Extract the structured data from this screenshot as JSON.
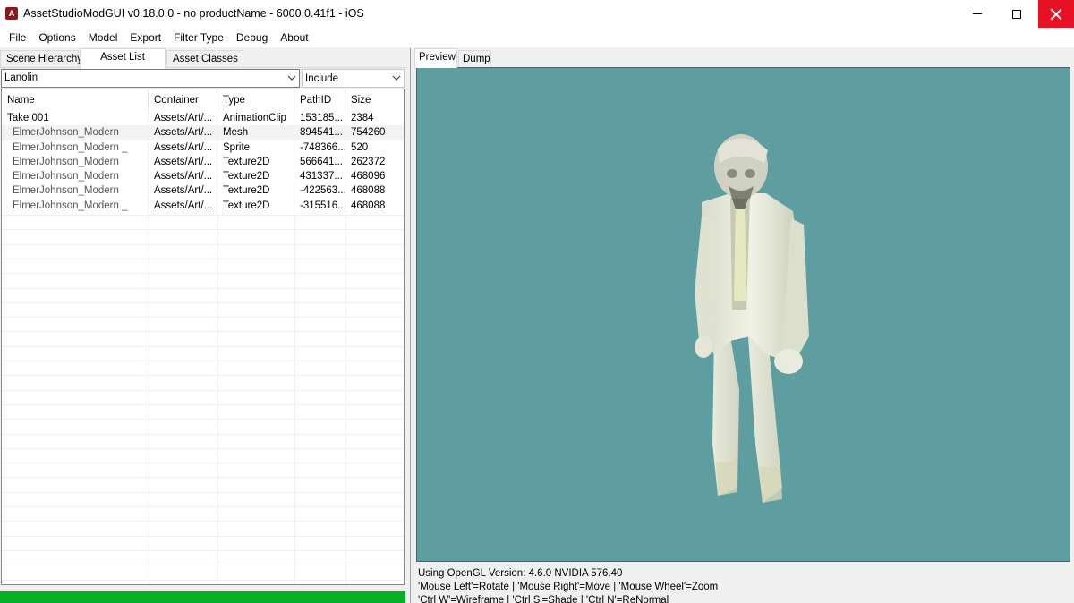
{
  "window": {
    "title": "AssetStudioModGUI v0.18.0.0 - no productName - 6000.0.41f1 - iOS",
    "icon_text": "A"
  },
  "menu": [
    "File",
    "Options",
    "Model",
    "Export",
    "Filter Type",
    "Debug",
    "About"
  ],
  "left_tabs": [
    "Scene Hierarchy",
    "Asset List",
    "Asset Classes"
  ],
  "active_left_tab": "Asset List",
  "filter": {
    "value": "Lanolin",
    "mode": "Include"
  },
  "columns": [
    "Name",
    "Container",
    "Type",
    "PathID",
    "Size"
  ],
  "rows": [
    {
      "name": "Take 001",
      "container": "Assets/Art/...",
      "type": "AnimationClip",
      "pathid": "153185...",
      "size": "2384"
    },
    {
      "name": "ElmerJohnson_Modern",
      "container": "Assets/Art/...",
      "type": "Mesh",
      "pathid": "894541...",
      "size": "754260"
    },
    {
      "name": "ElmerJohnson_Modern _",
      "container": "Assets/Art/...",
      "type": "Sprite",
      "pathid": "-748366...",
      "size": "520"
    },
    {
      "name": "ElmerJohnson_Modern",
      "container": "Assets/Art/...",
      "type": "Texture2D",
      "pathid": "566641...",
      "size": "262372"
    },
    {
      "name": "ElmerJohnson_Modern",
      "container": "Assets/Art/...",
      "type": "Texture2D",
      "pathid": "431337...",
      "size": "468096"
    },
    {
      "name": "ElmerJohnson_Modern",
      "container": "Assets/Art/...",
      "type": "Texture2D",
      "pathid": "-422563...",
      "size": "468088"
    },
    {
      "name": "ElmerJohnson_Modern _",
      "container": "Assets/Art/...",
      "type": "Texture2D",
      "pathid": "-315516...",
      "size": "468088"
    }
  ],
  "selected_row": 1,
  "progress": 1.0,
  "right_tabs": [
    "Preview",
    "Dump"
  ],
  "active_right_tab": "Preview",
  "status": [
    "Using OpenGL Version: 4.6.0 NVIDIA 576.40",
    "'Mouse Left'=Rotate | 'Mouse Right'=Move | 'Mouse Wheel'=Zoom",
    "'Ctrl W'=Wireframe | 'Ctrl S'=Shade | 'Ctrl N'=ReNormal"
  ],
  "colors": {
    "viewport_bg": "#5e9ea0",
    "progress_fill": "#06b025",
    "close_hover": "#e81123"
  }
}
